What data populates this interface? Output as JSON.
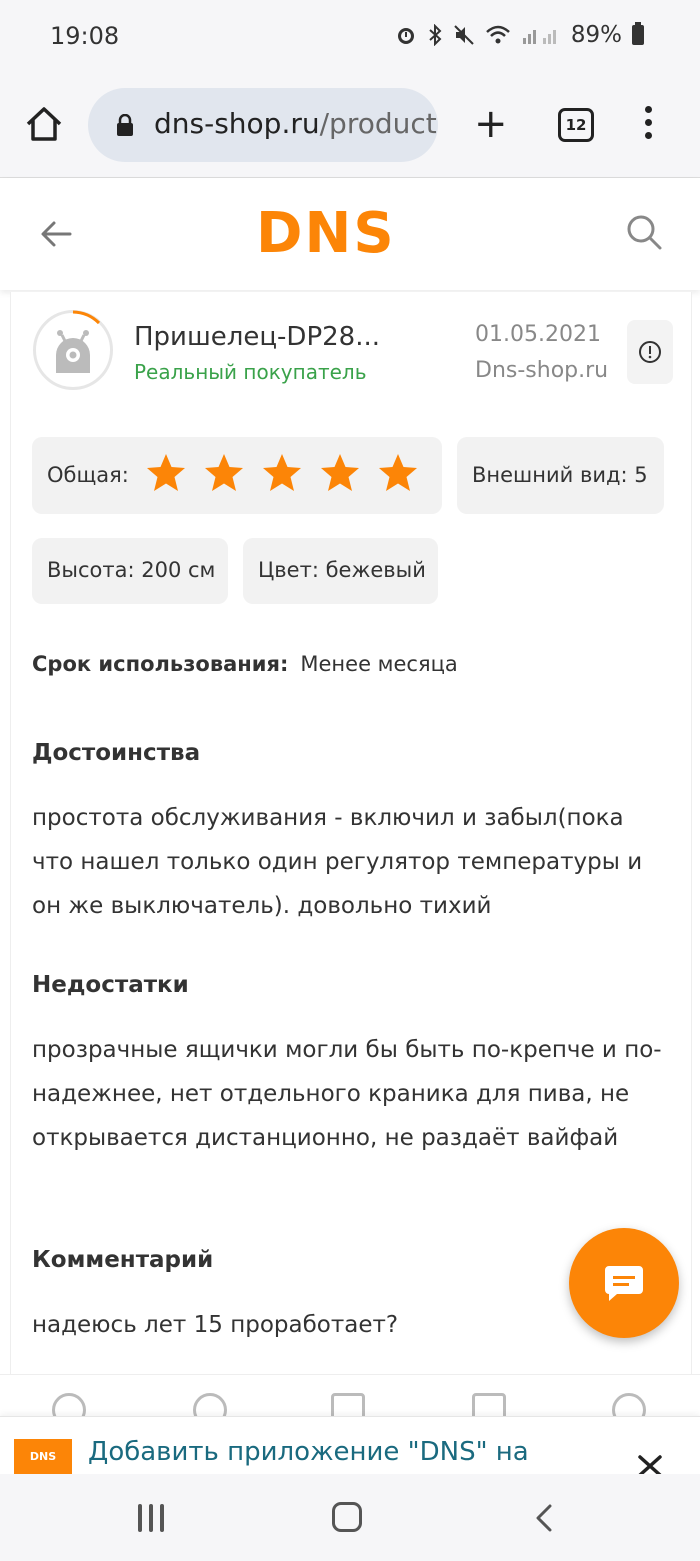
{
  "status_bar": {
    "time": "19:08",
    "battery": "89%",
    "icons": [
      "alarm-icon",
      "bluetooth-icon",
      "mute-icon",
      "wifi-icon",
      "signal-icon",
      "battery-icon"
    ]
  },
  "browser": {
    "url_domain": "dns-shop.ru",
    "url_path": "/product/",
    "tab_count": "12"
  },
  "site_header": {
    "logo": "DNS",
    "colors": {
      "brand": "#fc8507"
    }
  },
  "review": {
    "author": "Пришелец-DP28...",
    "author_badge": "Реальный покупатель",
    "date": "01.05.2021",
    "source": "Dns-shop.ru",
    "ratings": {
      "overall_label": "Общая:",
      "overall_stars": 5,
      "appearance": "Внешний вид: 5"
    },
    "attributes": {
      "height": "Высота: 200 см",
      "color": "Цвет: бежевый"
    },
    "usage_label": "Срок использования:",
    "usage_value": "Менее месяца",
    "pros_title": "Достоинства",
    "pros_text": "простота обслуживания - включил и забыл(пока что нашел только один регулятор температуры и он же выключатель).   довольно тихий",
    "cons_title": "Недостатки",
    "cons_text": "прозрачные ящички могли бы быть по-крепче и по-надежнее, нет отдельного краника для пива, не открывается дистанционно, не раздаёт вайфай",
    "comment_title": "Комментарий",
    "comment_text": "надеюсь лет 15 проработает?"
  },
  "install_banner": {
    "logo_text": "DNS",
    "text": "Добавить приложение \"DNS\" на"
  }
}
